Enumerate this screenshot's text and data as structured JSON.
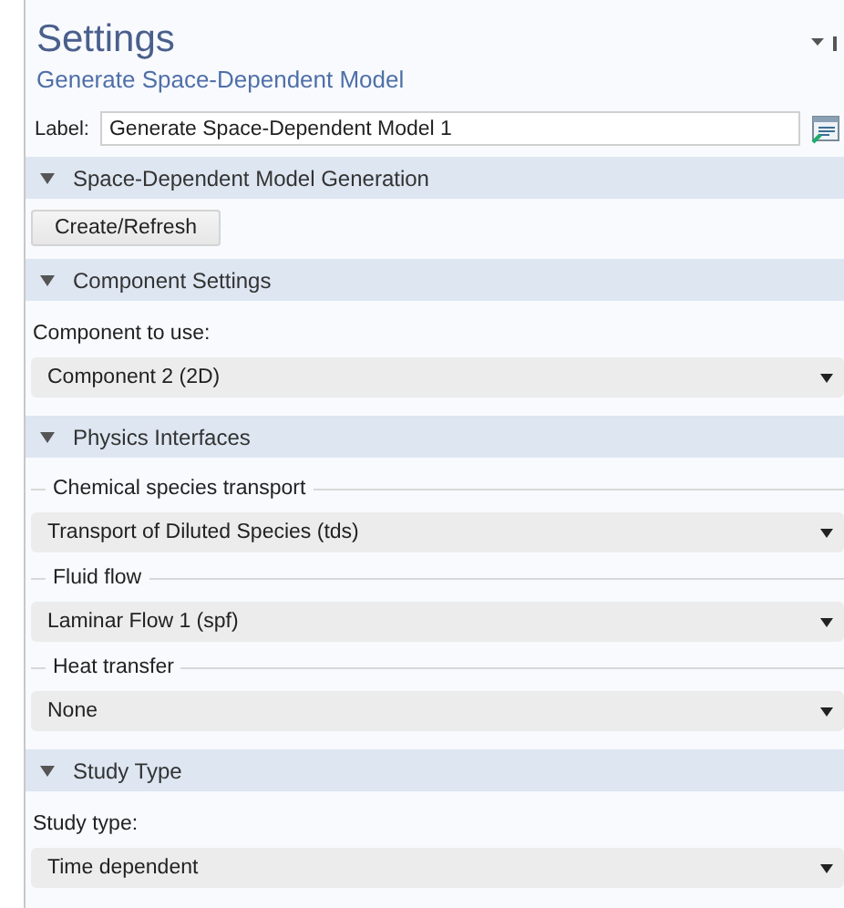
{
  "title": "Settings",
  "subtitle": "Generate Space-Dependent Model",
  "label_field": {
    "label": "Label:",
    "value": "Generate Space-Dependent Model 1"
  },
  "sections": [
    {
      "title": "Space-Dependent Model Generation",
      "expanded": true,
      "items": [
        {
          "kind": "button",
          "text": "Create/Refresh"
        }
      ]
    },
    {
      "title": "Component Settings",
      "expanded": true,
      "items": [
        {
          "kind": "label",
          "text": "Component to use:"
        },
        {
          "kind": "select",
          "value": "Component 2 (2D)"
        }
      ]
    },
    {
      "title": "Physics Interfaces",
      "expanded": true,
      "items": [
        {
          "kind": "group",
          "text": "Chemical species transport"
        },
        {
          "kind": "select",
          "value": "Transport of Diluted Species (tds)"
        },
        {
          "kind": "group",
          "text": "Fluid flow"
        },
        {
          "kind": "select",
          "value": "Laminar Flow 1 (spf)"
        },
        {
          "kind": "group",
          "text": "Heat transfer"
        },
        {
          "kind": "select",
          "value": "None"
        }
      ]
    },
    {
      "title": "Study Type",
      "expanded": true,
      "items": [
        {
          "kind": "label",
          "text": "Study type:"
        },
        {
          "kind": "select",
          "value": "Time dependent"
        }
      ]
    }
  ]
}
